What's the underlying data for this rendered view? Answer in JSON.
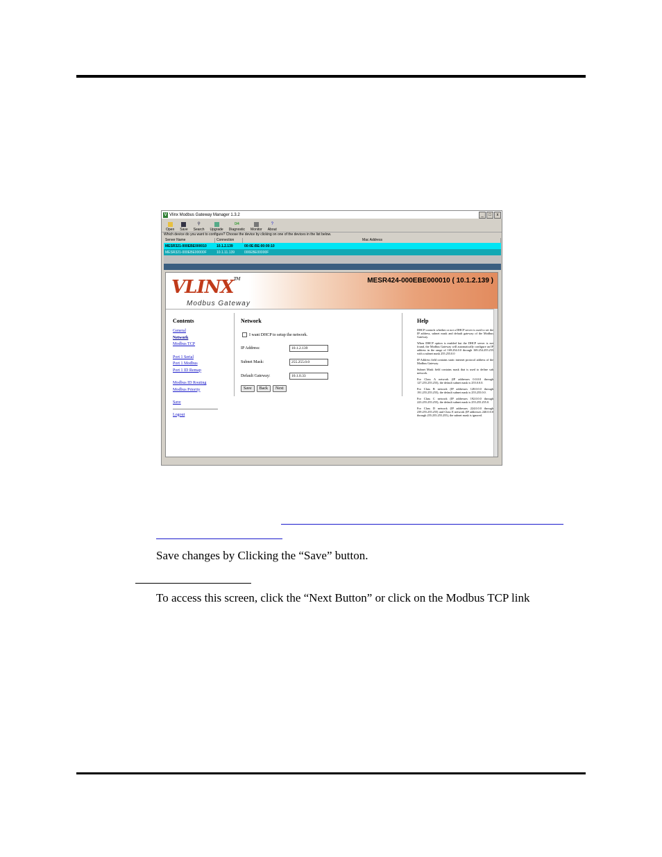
{
  "window": {
    "title": "Vlinx Modbus Gateway Manager 1.3.2",
    "title_buttons": [
      "_",
      "□",
      "x"
    ],
    "toolbar": [
      "Open",
      "Save",
      "Search",
      "Upgrade",
      "Diagnostic",
      "Monitor",
      "About"
    ],
    "hint": "Which device do you want to configure? Choose the device by clicking on one of the devices in the list below.",
    "columns": [
      "Server Name",
      "Connection",
      "Mac Address"
    ],
    "devices": [
      {
        "name": "MESR321-000EBE000010",
        "connection": "10.1.2.139",
        "mac": "00:0E:BE:00:00:10"
      },
      {
        "name": "MESR321-000EBE00000F",
        "connection": "10.1.11.139",
        "mac": "000EBE00000F"
      }
    ]
  },
  "page": {
    "brand": "VLINX",
    "brand_tm": "TM",
    "subbrand": "Modbus Gateway",
    "device_title": "MESR424-000EBE000010 ( 10.1.2.139 )",
    "contents_title": "Contents",
    "links_group1": [
      "General",
      "Network",
      "Modbus TCP"
    ],
    "links_group2": [
      "Port 1 Serial",
      "Port 1 Modbus",
      "Port 1 ID Remap"
    ],
    "links_group3": [
      "Modbus ID Routing",
      "Modbus Priority"
    ],
    "save_link": "Save",
    "logout_link": "Logout",
    "network_title": "Network",
    "dhcp_label": "I want DHCP to setup the network.",
    "ip_label": "IP Address:",
    "ip_value": "10.1.2.139",
    "mask_label": "Subnet Mask:",
    "mask_value": "255.255.0.0",
    "gateway_label": "Default Gateway:",
    "gateway_value": "10.1.0.33",
    "btn_save": "Save",
    "btn_back": "Back",
    "btn_next": "Next",
    "help_title": "Help",
    "help_paragraphs": [
      "DHCP controls whether or not a DHCP server is used to set the IP address, subnet mask and default gateway of the Modbus Gateway.",
      "When DHCP option is enabled but the DHCP server is not found, the Modbus Gateway will automatically configure an IP address in the range of 169.254.0.0 through 169.254.255.255 with a subnet mask 255.255.0.0",
      "IP Address field contains static internet protocol address of the Modbus Gateway.",
      "Subnet Mask field contains mask that is used to define sub network.",
      "For Class A network (IP addresses 0.0.0.0 through 127.255.255.255), the default subnet mask is 255.0.0.0.",
      "For Class B network (IP addresses 128.0.0.0 through 191.255.255.255), the default subnet mask is 255.255.0.0.",
      "For Class C network (IP addresses 192.0.0.0 through 223.255.255.255), the default subnet mask is 255.255.255.0.",
      "For Class D network (IP addresses 224.0.0.0 through 239.255.255.255) and Class E network (IP addresses 240.0.0.0 through 255.255.255.255), the subnet mask is ignored."
    ]
  },
  "doc": {
    "save_line": "Save changes by Clicking the “Save” button.",
    "access_line": "To access this screen, click the “Next Button” or click on the Modbus TCP link"
  }
}
